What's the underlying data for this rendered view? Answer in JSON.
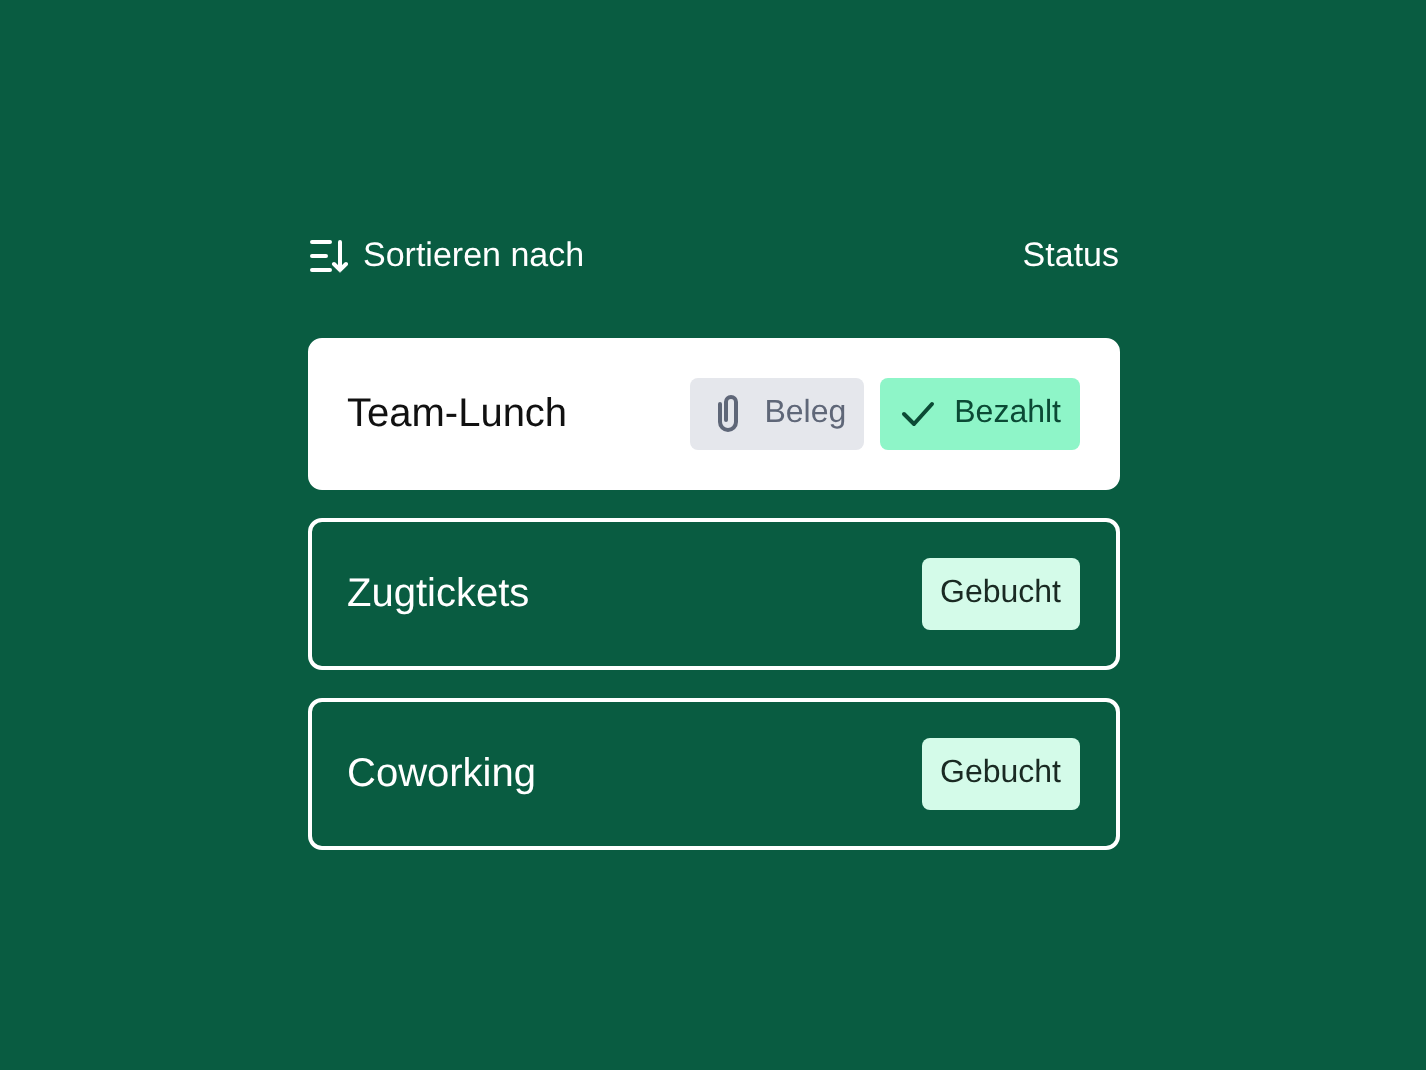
{
  "sort": {
    "label": "Sortieren nach",
    "value": "Status"
  },
  "items": [
    {
      "title": "Team-Lunch",
      "selected": true,
      "tags": [
        {
          "kind": "receipt",
          "label": "Beleg"
        },
        {
          "kind": "paid",
          "label": "Bezahlt"
        }
      ]
    },
    {
      "title": "Zugtickets",
      "selected": false,
      "tags": [
        {
          "kind": "booked",
          "label": "Gebucht"
        }
      ]
    },
    {
      "title": "Coworking",
      "selected": false,
      "tags": [
        {
          "kind": "booked",
          "label": "Gebucht"
        }
      ]
    }
  ]
}
